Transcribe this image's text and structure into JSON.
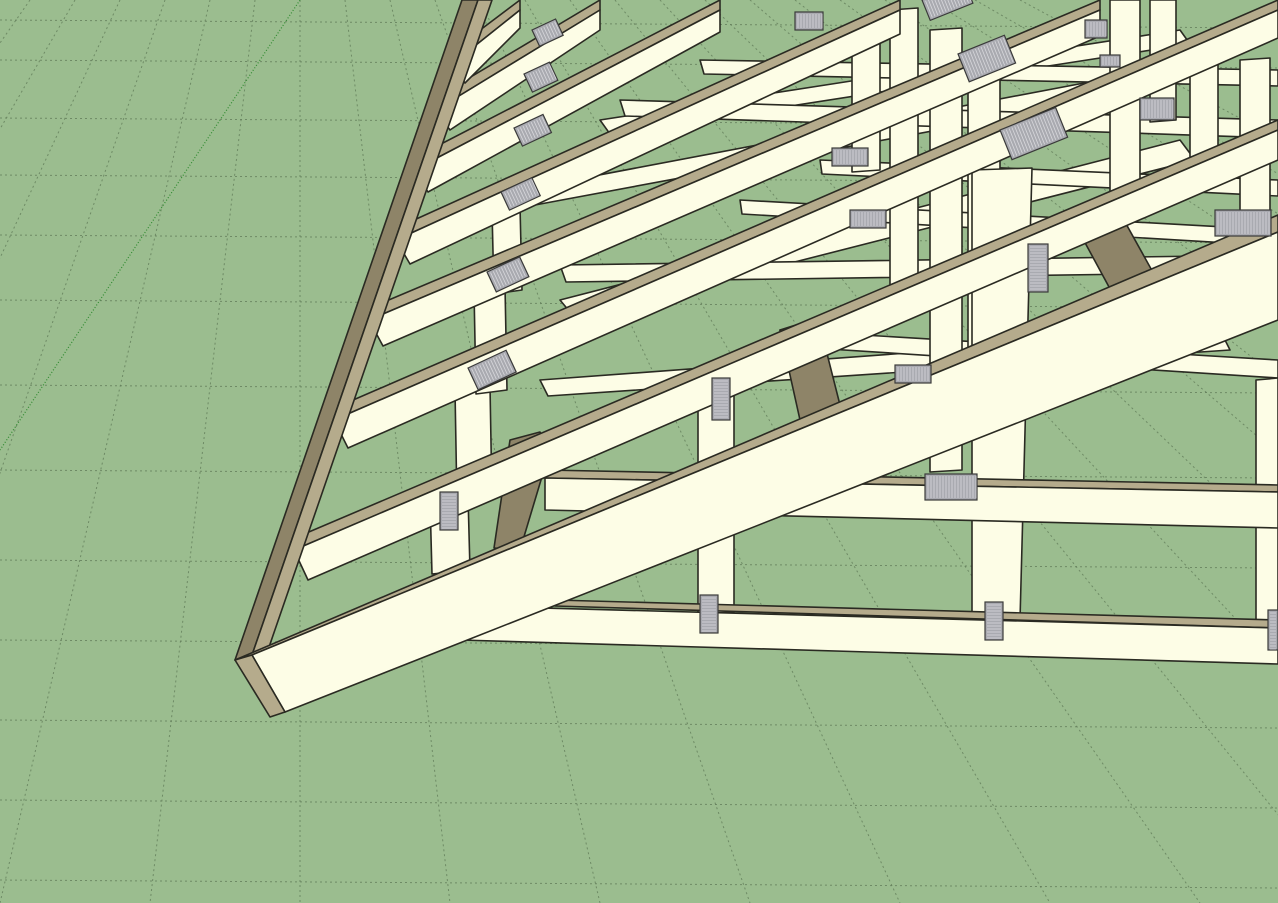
{
  "scene": {
    "ground_color": "#9bbd8f",
    "wood_face_color": "#fdfde6",
    "wood_side_color": "#b5ab8c",
    "plate_color": "#a9aab0"
  }
}
